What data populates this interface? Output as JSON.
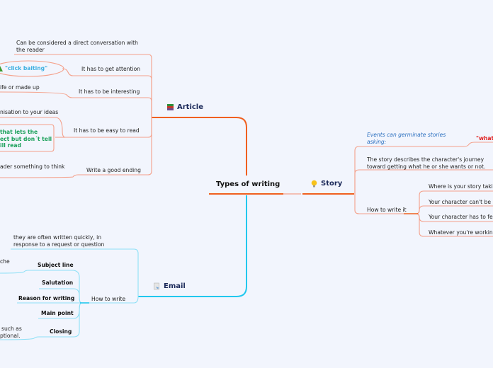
{
  "root": {
    "title": "Types of writing"
  },
  "colors": {
    "background": "#f2f5fd",
    "article_line": "#f06020",
    "article_sub_line": "#f4a08a",
    "email_line": "#22c8ee",
    "email_sub_line": "#8ee0f6",
    "story_line": "#f06020"
  },
  "article": {
    "label": "Article",
    "icon": "books-icon",
    "items": [
      {
        "label": "Can be considered a direct conversation with\nthe reader",
        "lines": [
          "Can be considered a direct conversation with",
          "the reader"
        ]
      },
      {
        "label": "It has to get attention",
        "children": [
          {
            "label": "\"click baiting\"",
            "style": "bubble"
          }
        ]
      },
      {
        "label": "It has to be interesting",
        "children": [
          {
            "label": "ife or made up"
          }
        ]
      },
      {
        "label": "It has to be easy to read",
        "children": [
          {
            "label": "nisation to your ideas"
          },
          {
            "lines": [
              "that lets the",
              "ect but don´t tell",
              "ill read"
            ],
            "style": "box"
          }
        ]
      },
      {
        "label": "Write a good ending",
        "children": [
          {
            "label": "ader something to think"
          }
        ]
      }
    ]
  },
  "story": {
    "label": "Story",
    "icon": "lightbulb-icon",
    "items": [
      {
        "lines": [
          "Events can germinate stories",
          "asking:"
        ],
        "children": [
          {
            "label": "\"what"
          }
        ]
      },
      {
        "lines": [
          "The story describes the character's journey",
          "toward getting what he or she wants or not."
        ]
      },
      {
        "label": "How to write it",
        "children": [
          {
            "label": "Where is your story taking"
          },
          {
            "label": "Your character can't be pe"
          },
          {
            "label": "Your character has to feel"
          },
          {
            "label": "Whatever you're working"
          }
        ]
      }
    ]
  },
  "email": {
    "label": "Email",
    "icon": "email-document-icon",
    "items": [
      {
        "lines": [
          "they are often written quickly, in",
          "response to a request or question"
        ]
      },
      {
        "label": "How to write",
        "children": [
          {
            "label": "Subject line",
            "children": [
              {
                "label": "che"
              }
            ]
          },
          {
            "label": "Salutation"
          },
          {
            "label": "Reason for writing"
          },
          {
            "label": "Main point"
          },
          {
            "label": "Closing",
            "children": [
              {
                "lines": [
                  "such as",
                  "ptional."
                ]
              }
            ]
          }
        ]
      }
    ]
  }
}
